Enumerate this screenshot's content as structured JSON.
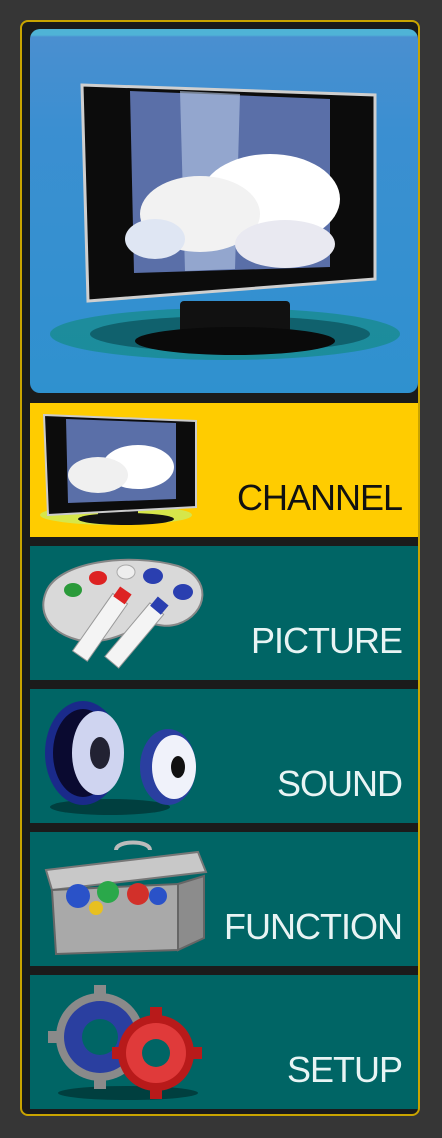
{
  "menu": {
    "items": [
      {
        "id": "channel",
        "label": "CHANNEL",
        "icon": "tv-icon",
        "selected": true
      },
      {
        "id": "picture",
        "label": "PICTURE",
        "icon": "paint-palette-icon",
        "selected": false
      },
      {
        "id": "sound",
        "label": "SOUND",
        "icon": "speaker-icon",
        "selected": false
      },
      {
        "id": "function",
        "label": "FUNCTION",
        "icon": "toolbox-icon",
        "selected": false
      },
      {
        "id": "setup",
        "label": "SETUP",
        "icon": "gears-icon",
        "selected": false
      }
    ]
  },
  "colors": {
    "frame_border": "#c9a400",
    "selected_bg": "#ffcc00",
    "item_bg": "#006565",
    "hero_bg": "#3b8fd1"
  }
}
